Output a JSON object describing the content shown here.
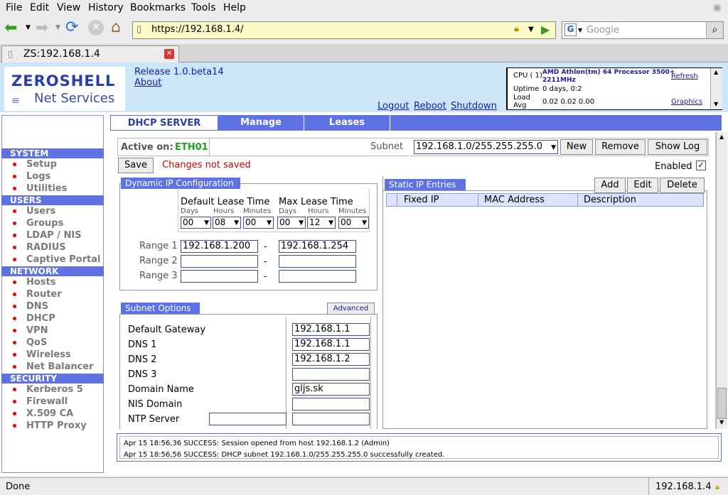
{
  "menu": [
    "File",
    "Edit",
    "View",
    "History",
    "Bookmarks",
    "Tools",
    "Help"
  ],
  "url": "https://192.168.1.4/",
  "search_placeholder": "Google",
  "tab_title": "ZS:192.168.1.4",
  "brand": {
    "line1": "ZEROSHELL",
    "line2": "Net Services"
  },
  "header": {
    "release": "Release 1.0.beta14",
    "about": "About",
    "logout": "Logout",
    "reboot": "Reboot",
    "shutdown": "Shutdown"
  },
  "cpu": {
    "label": "CPU ( 1)",
    "value": "AMD Athlon(tm) 64 Processor 3500+",
    "mhz": "2211MHz",
    "uptime_label": "Uptime",
    "uptime": "0 days, 0:2",
    "load_label": "Load",
    "avg_label": "Avg",
    "load": "0.02 0.02 0.00",
    "refresh": "Refresh",
    "graphics": "Graphics"
  },
  "sidebar": {
    "system": "SYSTEM",
    "system_items": [
      "Setup",
      "Logs",
      "Utilities"
    ],
    "users": "USERS",
    "users_items": [
      "Users",
      "Groups",
      "LDAP / NIS",
      "RADIUS",
      "Captive Portal"
    ],
    "network": "NETWORK",
    "network_items": [
      "Hosts",
      "Router",
      "DNS",
      "DHCP",
      "VPN",
      "QoS",
      "Wireless",
      "Net Balancer"
    ],
    "security": "SECURITY",
    "security_items": [
      "Kerberos 5",
      "Firewall",
      "X.509 CA",
      "HTTP Proxy"
    ]
  },
  "tabs": [
    "DHCP SERVER",
    "Manage",
    "Leases"
  ],
  "active_on_label": "Active on:",
  "active_on": "ETH01",
  "subnet_label": "Subnet",
  "subnet_value": "192.168.1.0/255.255.255.0",
  "buttons": {
    "new": "New",
    "remove": "Remove",
    "show_log": "Show Log",
    "save": "Save",
    "add": "Add",
    "edit": "Edit",
    "delete": "Delete",
    "advanced": "Advanced"
  },
  "changes": "Changes not saved",
  "enabled_label": "Enabled",
  "dynamic": {
    "title": "Dynamic IP Configuration",
    "default_lease": "Default Lease Time",
    "max_lease": "Max Lease Time",
    "days": "Days",
    "hours": "Hours",
    "minutes": "Minutes",
    "d_days": "00",
    "d_hours": "08",
    "d_min": "00",
    "m_days": "00",
    "m_hours": "12",
    "m_min": "00",
    "range_labels": [
      "Range 1",
      "Range 2",
      "Range 3"
    ],
    "range1_start": "192.168.1.200",
    "range1_end": "192.168.1.254",
    "dash": "-"
  },
  "static": {
    "title": "Static IP Entries",
    "cols": [
      "Fixed IP",
      "MAC Address",
      "Description"
    ]
  },
  "subnet_opts": {
    "title": "Subnet Options",
    "labels": [
      "Default Gateway",
      "DNS 1",
      "DNS 2",
      "DNS 3",
      "Domain Name",
      "NIS Domain",
      "NTP Server"
    ],
    "values": [
      "192.168.1.1",
      "192.168.1.1",
      "192.168.1.2",
      "",
      "gljs.sk",
      "",
      ""
    ]
  },
  "log": [
    "Apr 15 18:56,36 SUCCESS: Session opened from host 192.168.1.2 (Admin)",
    "Apr 15 18:56,56 SUCCESS: DHCP subnet 192.168.1.0/255.255.255.0 successfully created."
  ],
  "status": {
    "left": "Done",
    "right": "192.168.1.4"
  },
  "colors": {
    "accent": "#5e72e4",
    "header_bg": "#cbe7f7",
    "active_green": "#1aa51a",
    "warn_red": "#d00000"
  }
}
